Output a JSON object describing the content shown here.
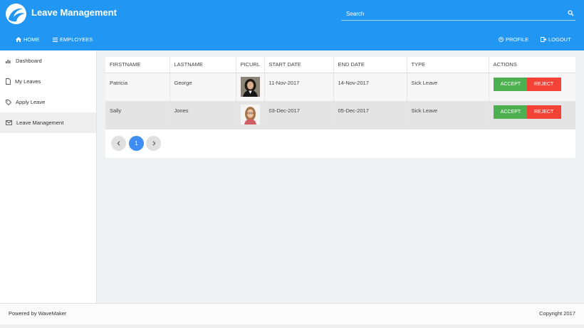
{
  "app": {
    "title": "Leave Management",
    "accent": "#2196f3",
    "logo": "wave-logo"
  },
  "search": {
    "placeholder": "Search"
  },
  "nav": {
    "home": "HOME",
    "employees": "EMPLOYEES",
    "profile": "PROFILE",
    "logout": "LOGOUT"
  },
  "sidebar": {
    "items": [
      {
        "label": "Dashboard",
        "icon": "bar-chart-icon"
      },
      {
        "label": "My Leaves",
        "icon": "document-icon"
      },
      {
        "label": "Apply Leave",
        "icon": "tag-icon"
      },
      {
        "label": "Leave Management",
        "icon": "envelope-icon",
        "active": true
      }
    ]
  },
  "table": {
    "columns": [
      "FIRSTNAME",
      "LASTNAME",
      "PICURL",
      "START DATE",
      "END DATE",
      "TYPE",
      "ACTIONS"
    ],
    "rows": [
      {
        "firstname": "Patricia",
        "lastname": "George",
        "start": "11-Nov-2017",
        "end": "14-Nov-2017",
        "type": "Sick Leave"
      },
      {
        "firstname": "Sally",
        "lastname": "Jones",
        "start": "03-Dec-2017",
        "end": "05-Dec-2017",
        "type": "Sick Leave"
      }
    ],
    "accept_label": "ACCEPT",
    "reject_label": "REJECT",
    "accept_color": "#4caf50",
    "reject_color": "#f44336"
  },
  "pagination": {
    "prev": "‹",
    "current": "1",
    "next": "›"
  },
  "footer": {
    "left": "Powered by WaveMaker",
    "right": "Copyright 2017"
  }
}
